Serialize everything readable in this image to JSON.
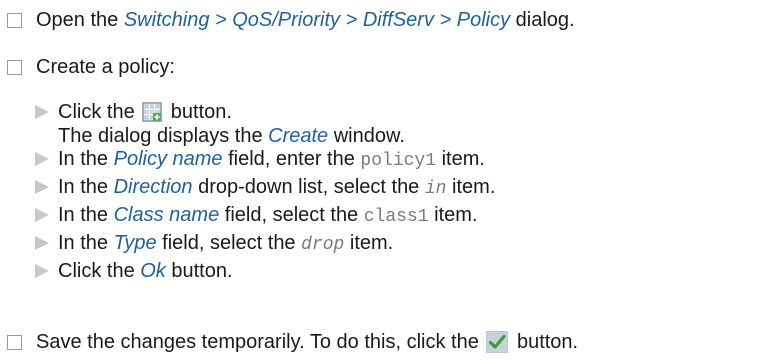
{
  "steps": [
    {
      "pre": "Open the ",
      "path": "Switching > QoS/Priority > DiffServ > Policy",
      "post": " dialog."
    },
    {
      "text": "Create a policy:",
      "substeps": [
        {
          "pre": "Click the ",
          "icon": "create-table-icon",
          "post": " button.",
          "result_pre": "The dialog displays the ",
          "result_ui": "Create",
          "result_post": " window."
        },
        {
          "pre": "In the ",
          "ui": "Policy name",
          "mid": " field, enter the ",
          "value": "policy1",
          "post": " item."
        },
        {
          "pre": "In the ",
          "ui": "Direction",
          "mid": " drop-down list, select the ",
          "value": "in",
          "post": " item."
        },
        {
          "pre": "In the ",
          "ui": "Class name",
          "mid": " field, select the ",
          "value": "class1",
          "post": " item."
        },
        {
          "pre": "In the ",
          "ui": "Type",
          "mid": " field, select the ",
          "value": "drop",
          "post": " item."
        },
        {
          "pre": "Click the ",
          "ui": "Ok",
          "post": " button."
        }
      ]
    },
    {
      "pre": "Save the changes temporarily. To do this, click the ",
      "icon": "checkmark-icon",
      "post": " button."
    }
  ]
}
